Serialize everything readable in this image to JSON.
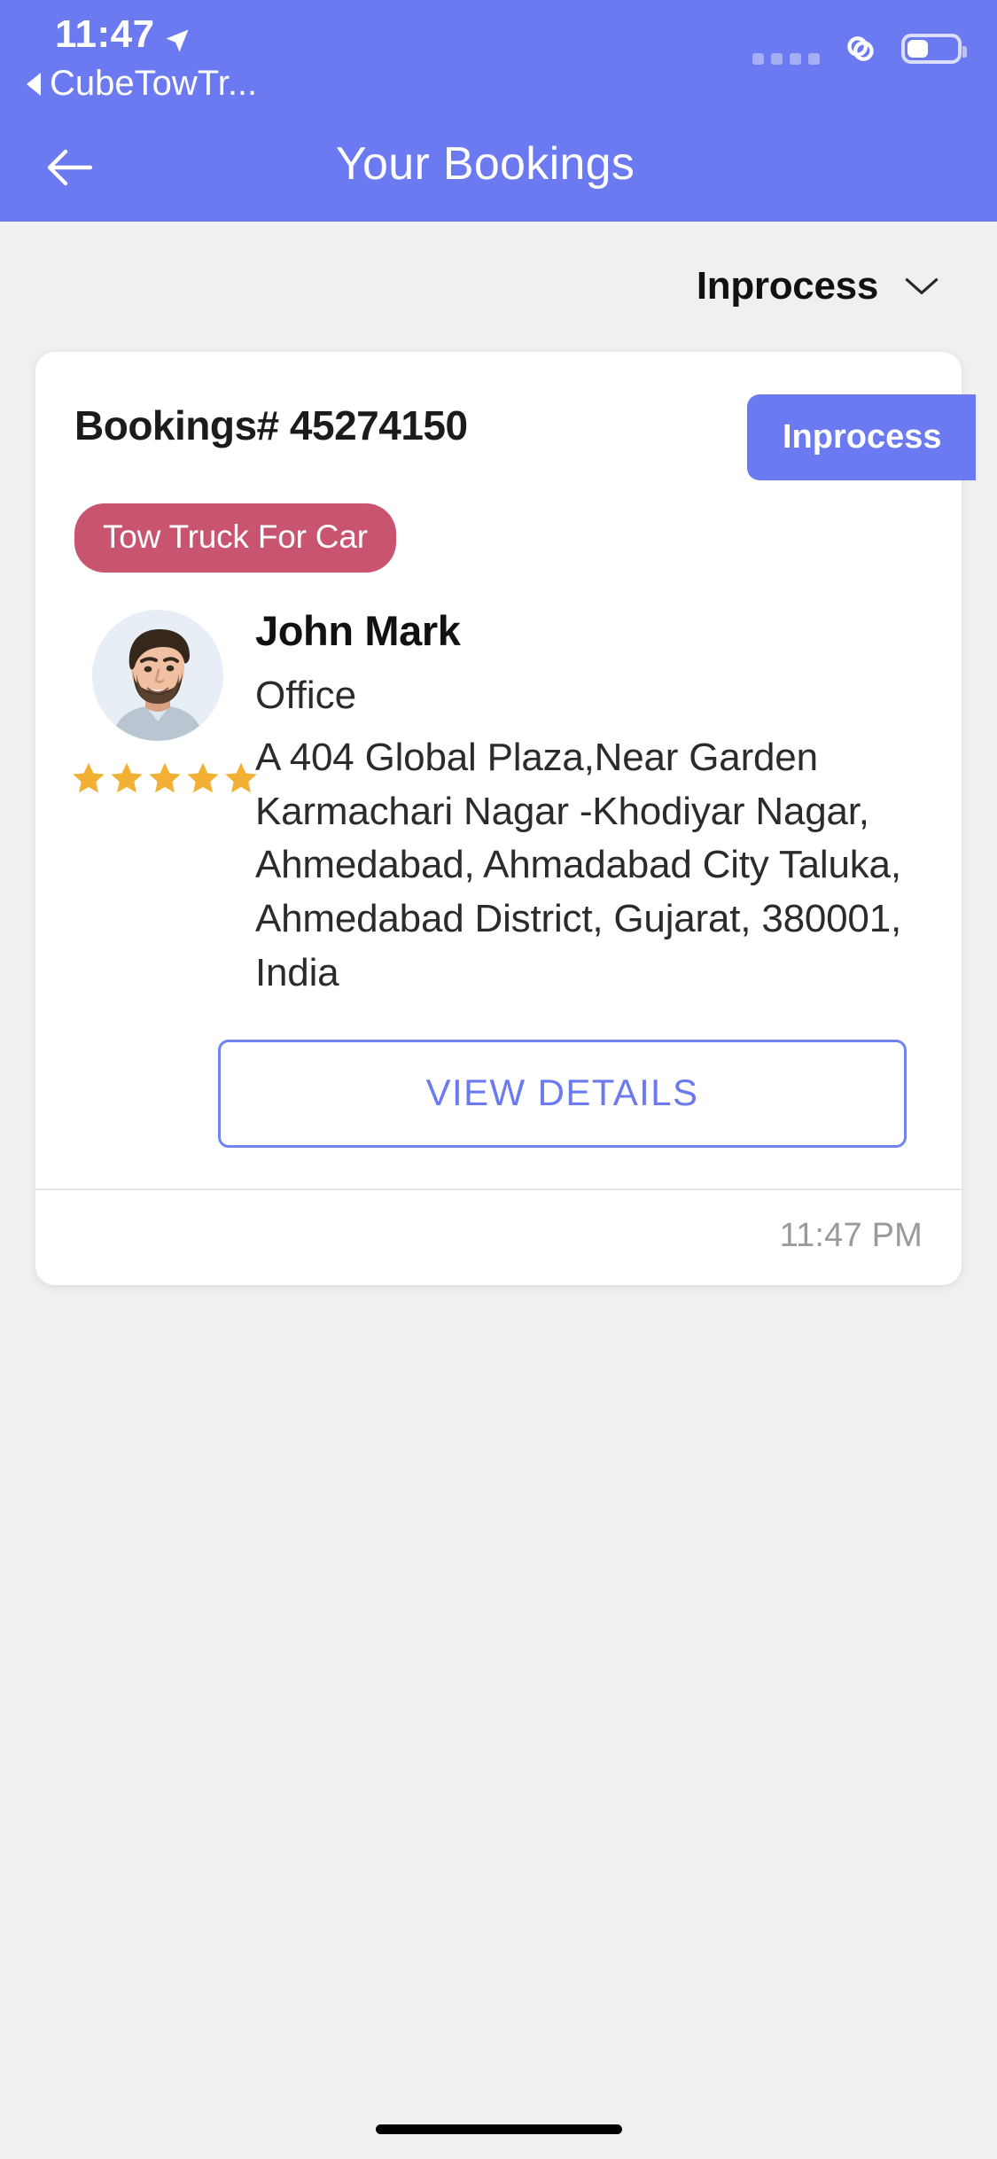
{
  "status_bar": {
    "time": "11:47",
    "back_app_label": "CubeTowTr...",
    "location_icon": "location-arrow-icon",
    "signal_dots": 4,
    "link_icon": "chain-link-icon",
    "battery_level_percent": 42
  },
  "nav": {
    "back_icon": "arrow-left-icon",
    "title": "Your Bookings"
  },
  "filter": {
    "selected": "Inprocess",
    "chevron_icon": "chevron-down-icon"
  },
  "booking": {
    "number_label": "Bookings# 45274150",
    "status": "Inprocess",
    "service_tag": "Tow Truck For Car",
    "provider": {
      "name": "John Mark",
      "type": "Office",
      "address": "A 404 Global Plaza,Near Garden Karmachari Nagar -Khodiyar Nagar, Ahmedabad, Ahmadabad City Taluka, Ahmedabad District, Gujarat, 380001, India",
      "rating": 5,
      "star_icon": "star-filled-icon",
      "avatar_icon": "avatar-photo"
    },
    "view_details_label": "VIEW DETAILS",
    "timestamp": "11:47 PM"
  },
  "colors": {
    "brand": "#6b7af0",
    "tag": "#c9546f",
    "star": "#f2b134",
    "page_bg": "#f0f0f0"
  }
}
